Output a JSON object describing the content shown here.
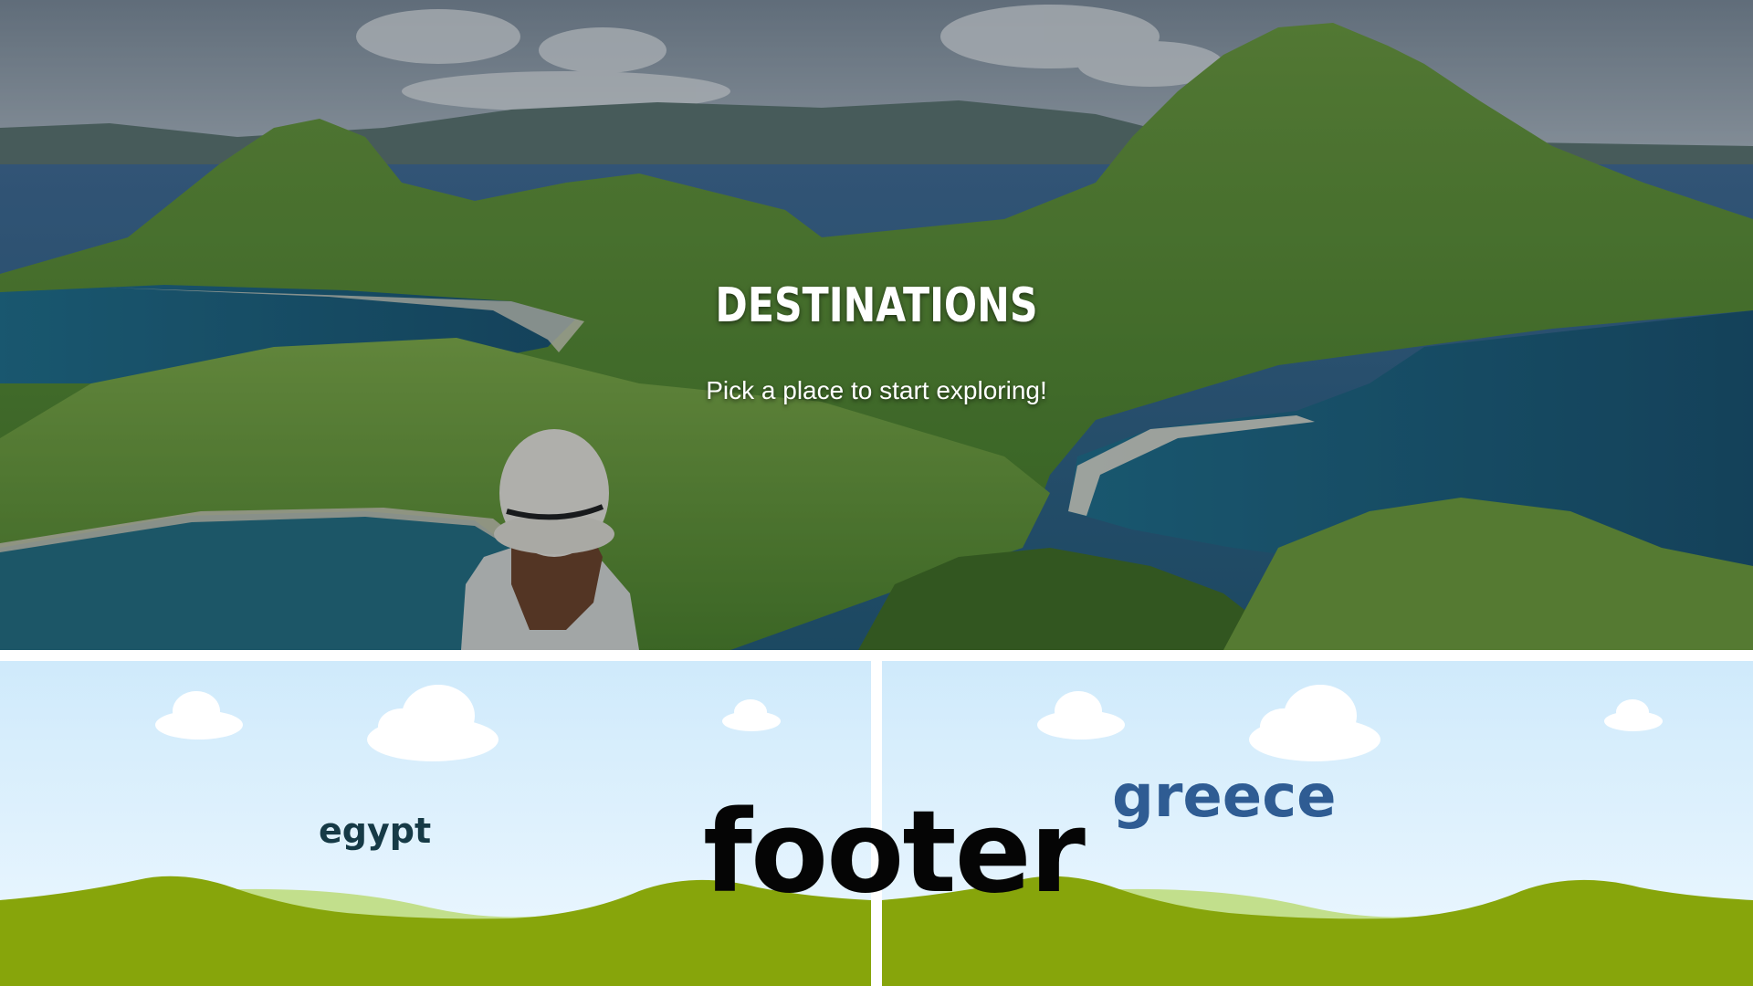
{
  "hero": {
    "title": "DESTINATIONS",
    "subtitle": "Pick a place to start exploring!",
    "image": "island-landscape-with-traveler"
  },
  "cards": [
    {
      "label": "egypt",
      "color": "#163a46",
      "scene": "cartoon-hills-sky"
    },
    {
      "label": "greece",
      "color": "#2f5c93",
      "scene": "cartoon-hills-sky"
    }
  ],
  "footer": {
    "label": "footer"
  },
  "colors": {
    "sky_top": "#cfeafb",
    "sky_bottom": "#eef8ff",
    "hill_light": "#c2df8c",
    "hill_dark": "#87a50b"
  }
}
